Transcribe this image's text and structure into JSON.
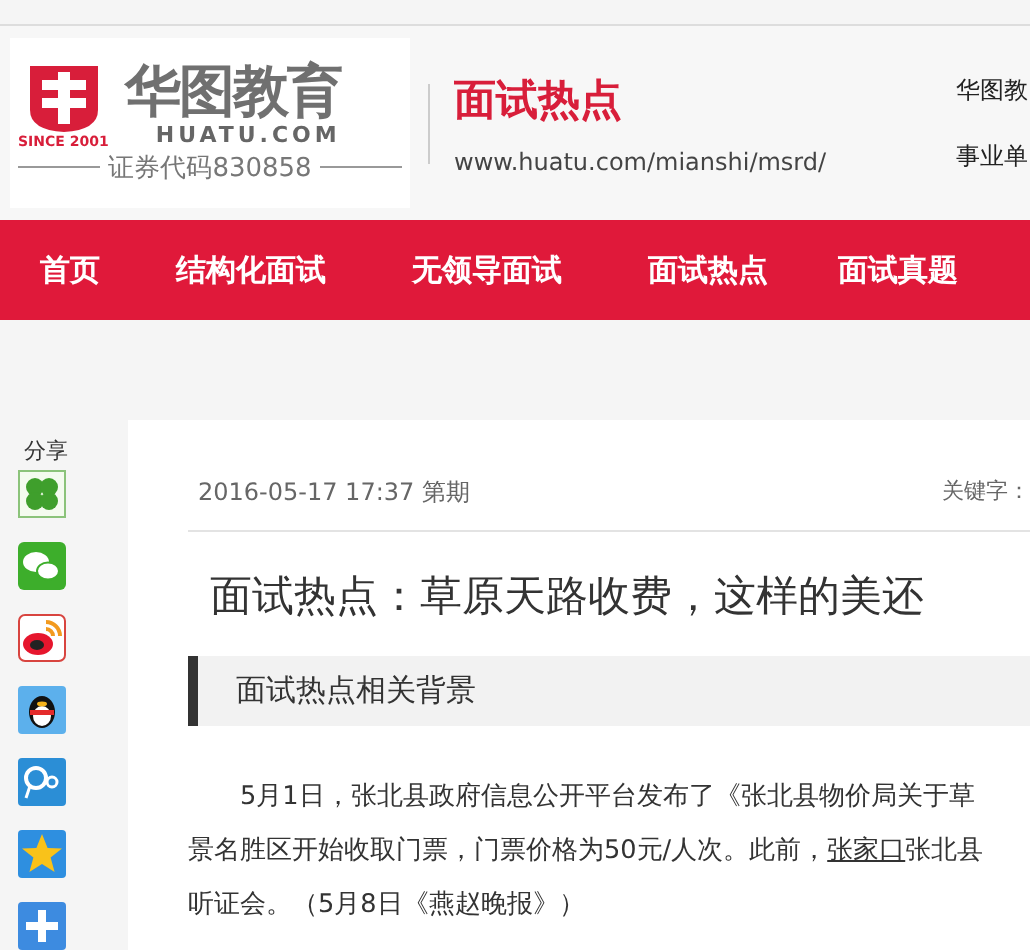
{
  "logo": {
    "since": "SINCE 2001",
    "name": "华图教育",
    "domain": "HUATU.COM",
    "stock": "证券代码830858"
  },
  "channel": {
    "title": "面试热点",
    "url": "www.huatu.com/mianshi/msrd/"
  },
  "top_links": [
    "华图教",
    "事业单"
  ],
  "nav": [
    {
      "label": "首页"
    },
    {
      "label": "结构化面试"
    },
    {
      "label": "无领导面试"
    },
    {
      "label": "面试热点"
    },
    {
      "label": "面试真题"
    }
  ],
  "share": {
    "label": "分享",
    "icons": [
      {
        "kind": "clover"
      },
      {
        "kind": "wechat"
      },
      {
        "kind": "weibo"
      },
      {
        "kind": "qq"
      },
      {
        "kind": "circle"
      },
      {
        "kind": "qzone"
      },
      {
        "kind": "plus"
      }
    ]
  },
  "article": {
    "meta": "2016-05-17 17:37 第期",
    "keywords": "关键字：",
    "title": "面试热点：草原天路收费，这样的美还",
    "section": "面试热点相关背景",
    "lines": [
      {
        "indent": true,
        "parts": [
          {
            "text": "5月1日，张北县政府信息公开平台发布了《张北县物价局关于草"
          }
        ]
      },
      {
        "indent": false,
        "parts": [
          {
            "text": "景名胜区开始收取门票，门票价格为50元/人次。此前，"
          },
          {
            "text": "张家口",
            "link": true
          },
          {
            "text": "张北县"
          }
        ]
      },
      {
        "indent": false,
        "parts": [
          {
            "text": "听证会。（5月8日《燕赵晚报》）"
          }
        ]
      }
    ]
  }
}
